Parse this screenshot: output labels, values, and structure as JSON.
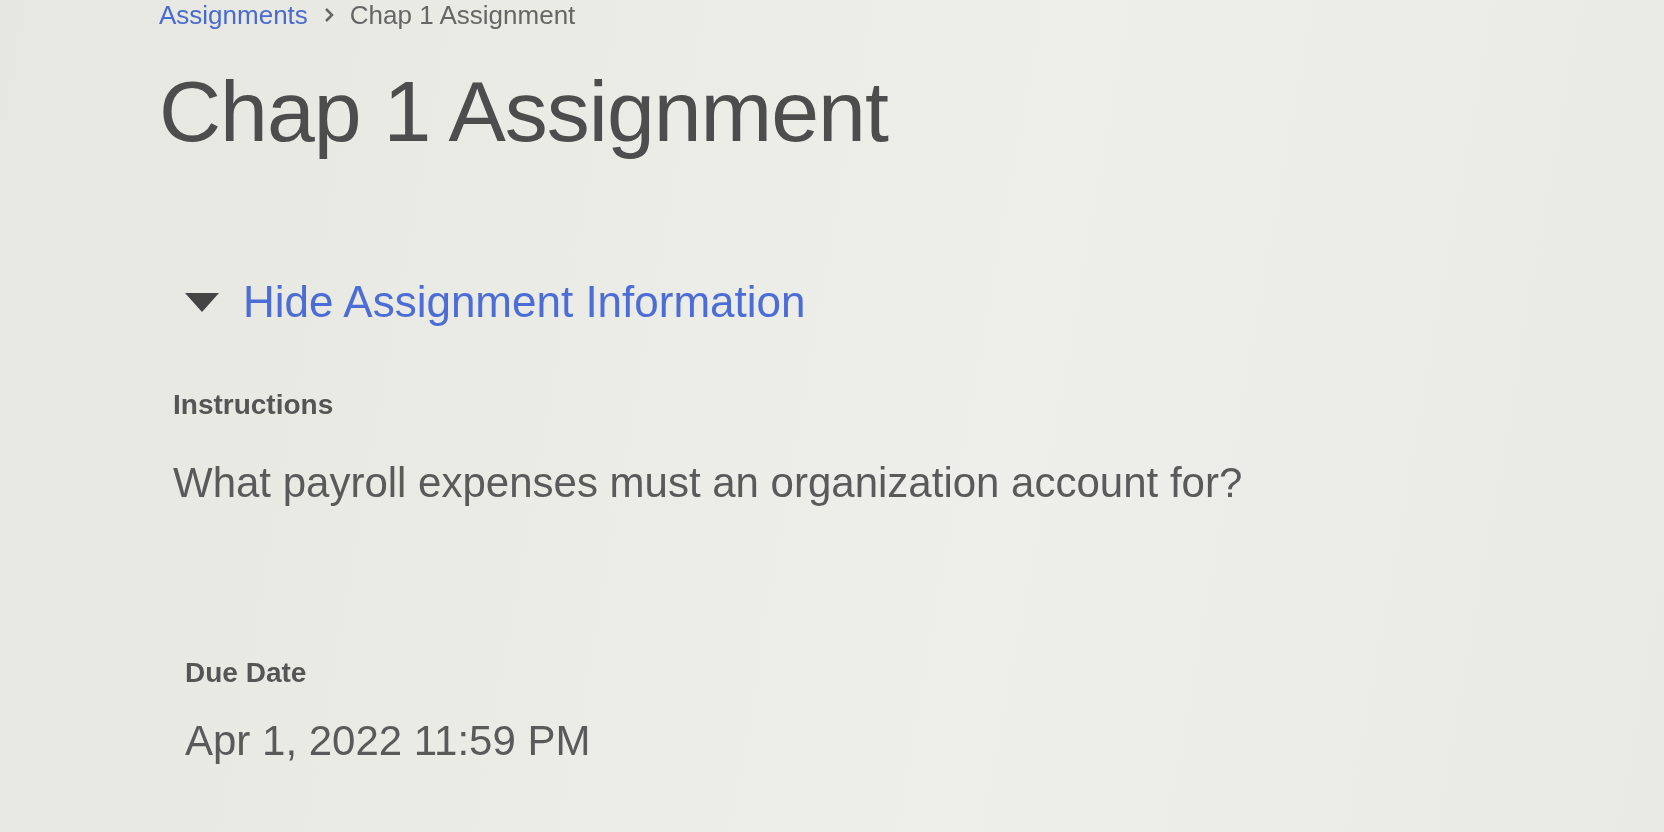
{
  "breadcrumb": [
    "Assignments",
    "Chap 1 Assignment"
  ],
  "title": "Chap 1 Assignment",
  "info_toggle": {
    "label": "Hide Assignment Information",
    "expanded": true
  },
  "instructions": {
    "label": "Instructions",
    "text": "What payroll expenses must an organization account for?"
  },
  "due_date": {
    "label": "Due Date",
    "value": "Apr 1, 2022 11:59 PM"
  }
}
